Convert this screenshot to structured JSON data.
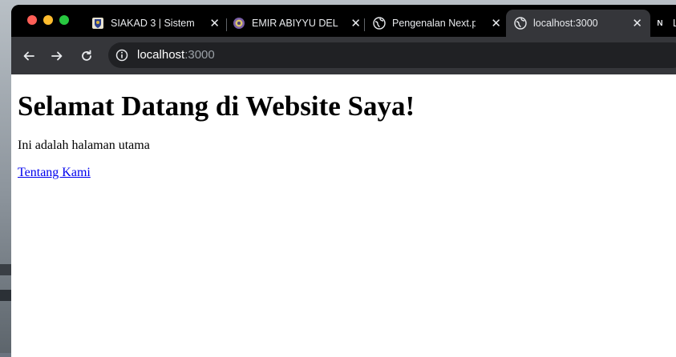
{
  "browser": {
    "tabs": [
      {
        "title": "SIAKAD 3 | Sistem",
        "favicon": "university-crest-icon",
        "active": false
      },
      {
        "title": "EMIR ABIYYU DEL",
        "favicon": "university-seal-icon",
        "active": false
      },
      {
        "title": "Pengenalan Next.p",
        "favicon": "globe-icon",
        "active": false
      },
      {
        "title": "localhost:3000",
        "favicon": "globe-icon",
        "active": true
      },
      {
        "title": "L",
        "favicon": "nextjs-icon",
        "active": false
      }
    ],
    "address": {
      "host": "localhost",
      "port": ":3000"
    },
    "colors": {
      "tabbar": "#000000",
      "toolbar": "#35363a",
      "omnibox": "#202124",
      "close": "#ff5f57",
      "minimize": "#febc2e",
      "zoom": "#28c840"
    }
  },
  "page": {
    "heading": "Selamat Datang di Website Saya!",
    "paragraph": "Ini adalah halaman utama",
    "link": "Tentang Kami",
    "link_color": "#0000ee"
  }
}
